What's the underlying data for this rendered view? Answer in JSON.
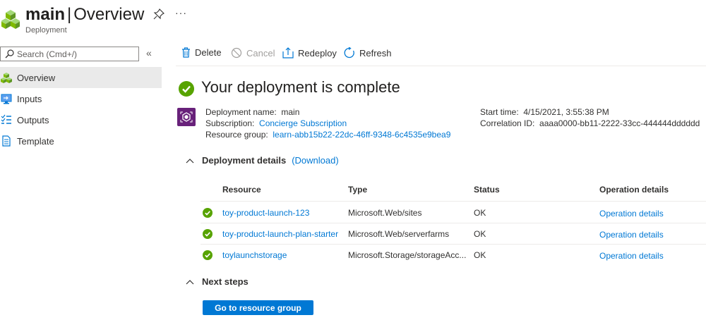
{
  "header": {
    "title_bold": "main",
    "title_sep": "|",
    "title_rest": "Overview",
    "subtitle": "Deployment",
    "more_label": "···"
  },
  "sidebar": {
    "search_placeholder": "Search (Cmd+/)",
    "collapse_label": "«",
    "items": [
      {
        "label": "Overview",
        "icon": "cubes-icon",
        "active": true
      },
      {
        "label": "Inputs",
        "icon": "inputs-icon",
        "active": false
      },
      {
        "label": "Outputs",
        "icon": "outputs-icon",
        "active": false
      },
      {
        "label": "Template",
        "icon": "template-icon",
        "active": false
      }
    ]
  },
  "toolbar": {
    "delete_label": "Delete",
    "cancel_label": "Cancel",
    "redeploy_label": "Redeploy",
    "refresh_label": "Refresh"
  },
  "main": {
    "status_title": "Your deployment is complete",
    "deployment_name_label": "Deployment name:",
    "deployment_name": "main",
    "subscription_label": "Subscription:",
    "subscription": "Concierge Subscription",
    "resource_group_label": "Resource group:",
    "resource_group": "learn-abb15b22-22dc-46ff-9348-6c4535e9bea9",
    "start_time_label": "Start time:",
    "start_time": "4/15/2021, 3:55:38 PM",
    "correlation_label": "Correlation ID:",
    "correlation_id": "aaaa0000-bb11-2222-33cc-444444dddddd"
  },
  "details": {
    "title": "Deployment details",
    "download_label": "(Download)",
    "columns": {
      "resource": "Resource",
      "type": "Type",
      "status": "Status",
      "operation": "Operation details"
    },
    "rows": [
      {
        "resource": "toy-product-launch-123",
        "type": "Microsoft.Web/sites",
        "status": "OK",
        "operation": "Operation details"
      },
      {
        "resource": "toy-product-launch-plan-starter",
        "type": "Microsoft.Web/serverfarms",
        "status": "OK",
        "operation": "Operation details"
      },
      {
        "resource": "toylaunchstorage",
        "type": "Microsoft.Storage/storageAcc...",
        "status": "OK",
        "operation": "Operation details"
      }
    ]
  },
  "next_steps": {
    "title": "Next steps",
    "button_label": "Go to resource group"
  },
  "colors": {
    "accent": "#0078d4",
    "success": "#57a300",
    "active_bg": "#eaeaea"
  }
}
